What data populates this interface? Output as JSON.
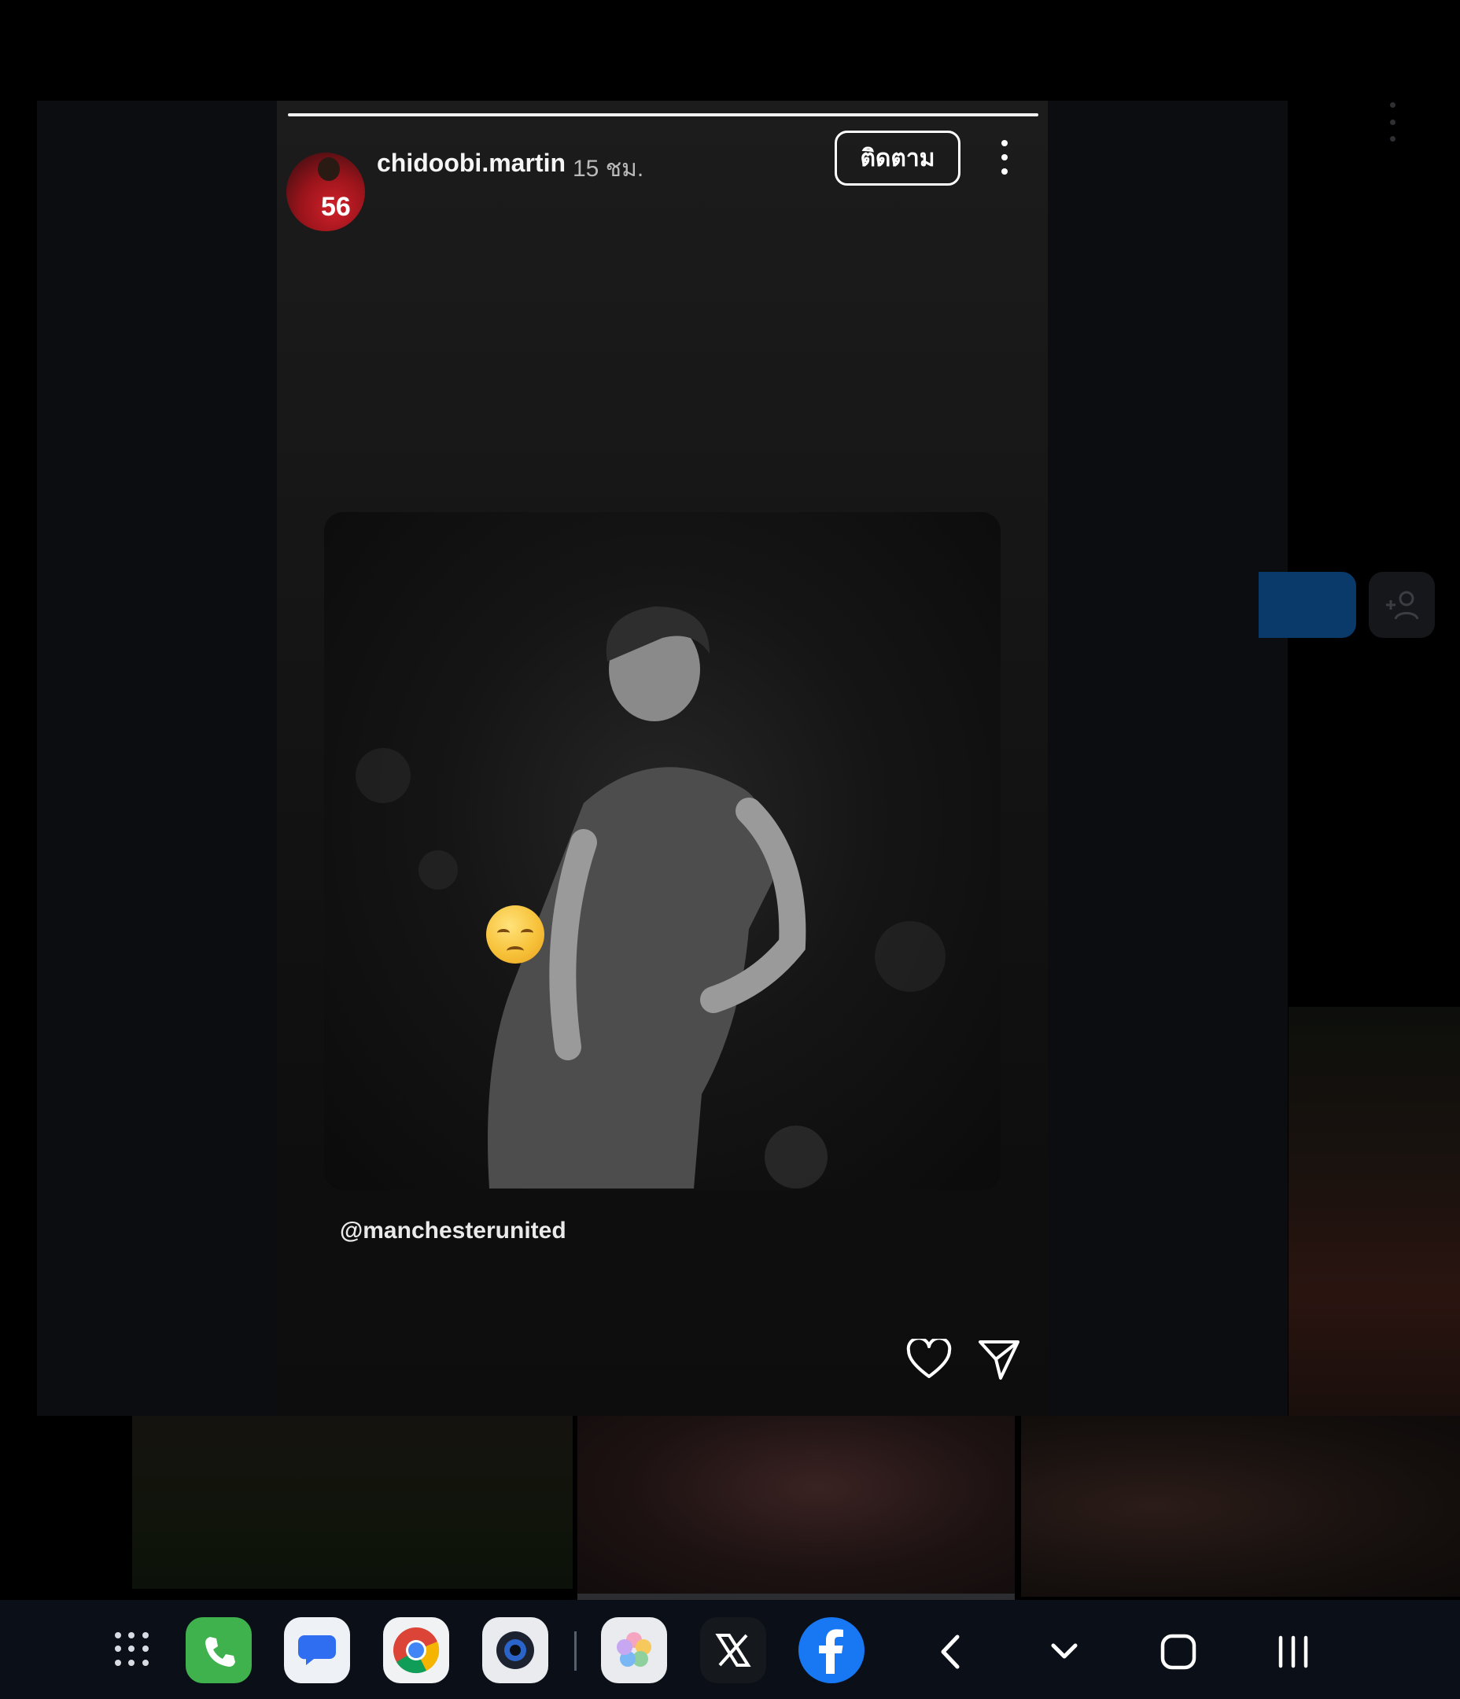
{
  "story": {
    "username": "chidoobi.martin",
    "time": "15 ชม.",
    "follow_label": "ติดตาม",
    "avatar_number": "56",
    "mention": "@manchesterunited",
    "progress": 1.0
  },
  "photo": {
    "emoji": "😔"
  },
  "taskbar": {
    "apps": [
      "apps-grid",
      "phone",
      "messages",
      "chrome",
      "camera",
      "gallery",
      "x",
      "facebook"
    ],
    "nav": [
      "back",
      "hide-keyboard",
      "home",
      "recents"
    ]
  },
  "colors": {
    "story_bg": "#151515",
    "taskbar_bg": "#0b1018",
    "facebook_blue": "#1877f2",
    "phone_green": "#3fb24d"
  }
}
